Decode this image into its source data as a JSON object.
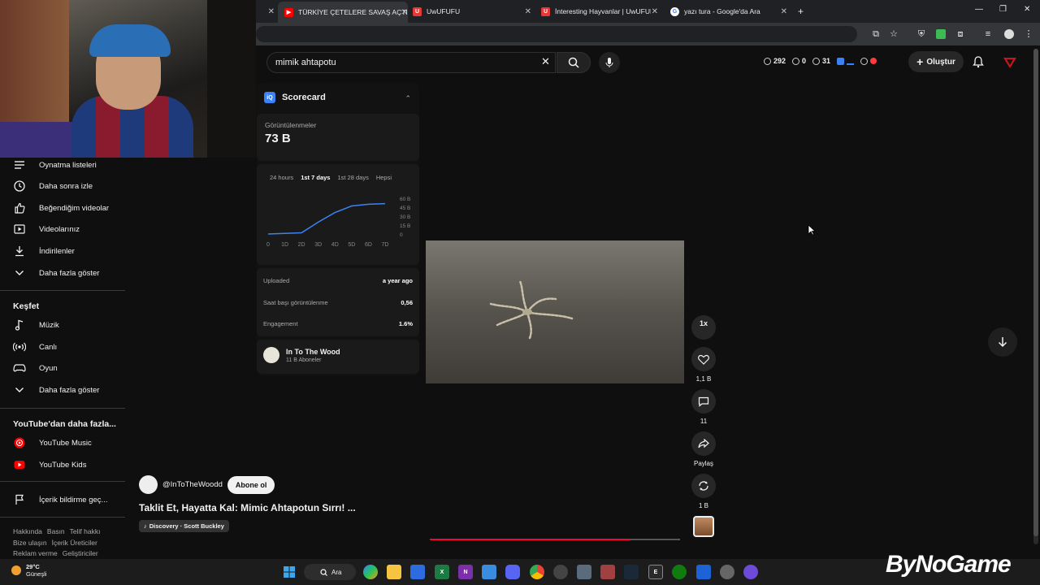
{
  "browser": {
    "tabs": [
      {
        "label": "TÜRKİYE ÇETELERE SAVAŞ AÇTI",
        "icon": "youtube-icon",
        "color": "#ff0000"
      },
      {
        "label": "UwUFUFU",
        "icon": "uwufufu-icon",
        "color": "#e53935"
      },
      {
        "label": "İnteresting Hayvanlar | UwUFUFU",
        "icon": "uwufufu-icon",
        "color": "#e53935"
      },
      {
        "label": "yazı tura - Google'da Ara",
        "icon": "google-icon",
        "color": "#4285f4"
      }
    ],
    "new_tab_label": "+"
  },
  "header": {
    "search_value": "mimik ahtapotu",
    "stats": {
      "clock": "292",
      "likes": "0",
      "views": "31"
    },
    "create_label": "Oluştur"
  },
  "sidebar": {
    "items_top": [
      {
        "label": "Oynatma listeleri",
        "icon": "playlist-icon"
      },
      {
        "label": "Daha sonra izle",
        "icon": "clock-icon"
      },
      {
        "label": "Beğendiğim videolar",
        "icon": "thumbs-up-icon"
      },
      {
        "label": "Videolarınız",
        "icon": "video-icon"
      },
      {
        "label": "İndirilenler",
        "icon": "download-icon"
      },
      {
        "label": "Daha fazla göster",
        "icon": "chevron-down-icon"
      }
    ],
    "explore_title": "Keşfet",
    "explore_items": [
      {
        "label": "Müzik",
        "icon": "music-icon"
      },
      {
        "label": "Canlı",
        "icon": "live-icon"
      },
      {
        "label": "Oyun",
        "icon": "gaming-icon"
      },
      {
        "label": "Daha fazla göster",
        "icon": "chevron-down-icon"
      }
    ],
    "more_title": "YouTube'dan daha fazla...",
    "more_items": [
      {
        "label": "YouTube Music",
        "icon": "youtube-music-icon"
      },
      {
        "label": "YouTube Kids",
        "icon": "youtube-kids-icon"
      }
    ],
    "report_label": "İçerik bildirme geç...",
    "footer_rows": [
      [
        "Hakkında",
        "Basın",
        "Telif hakkı"
      ],
      [
        "Bize ulaşın",
        "İçerik Üreticiler"
      ],
      [
        "Reklam verme",
        "Geliştiriciler"
      ]
    ]
  },
  "scorecard": {
    "title": "Scorecard",
    "views_label": "Görüntülenmeler",
    "views_value": "73 B",
    "tabs": [
      "24 hours",
      "1st 7 days",
      "1st 28 days",
      "Hepsi"
    ],
    "active_tab": "1st 7 days",
    "rows": [
      {
        "label": "Uploaded",
        "value": "a year ago"
      },
      {
        "label": "Saat başı görüntülenme",
        "value": "0,56"
      },
      {
        "label": "Engagement",
        "value": "1.6%"
      }
    ],
    "channel_name": "In To The Wood",
    "channel_subs": "11 B Aboneler"
  },
  "chart_data": {
    "type": "line",
    "x": [
      "0",
      "1D",
      "2D",
      "3D",
      "4D",
      "5D",
      "6D",
      "7D"
    ],
    "values": [
      0,
      1,
      2,
      20,
      36,
      47,
      50,
      51
    ],
    "yticks": [
      "60 B",
      "45 B",
      "30 B",
      "15 B",
      "0"
    ],
    "ylim": [
      0,
      60
    ],
    "color": "#3b82f6"
  },
  "actions": {
    "speed": "1x",
    "likes": "1,1 B",
    "comments": "11",
    "share": "Paylaş",
    "remix": "1 B"
  },
  "video": {
    "channel_handle": "@InToTheWoodd",
    "subscribe_label": "Abone ol",
    "title": "Taklit Et, Hayatta Kal: Mimic Ahtapotun Sırrı! ...",
    "sound": "Discovery · Scott Buckley",
    "progress": 0.8
  },
  "taskbar": {
    "temp": "29°C",
    "weather": "Güneşli",
    "search_label": "Ara"
  },
  "watermark": "ByNoGame"
}
